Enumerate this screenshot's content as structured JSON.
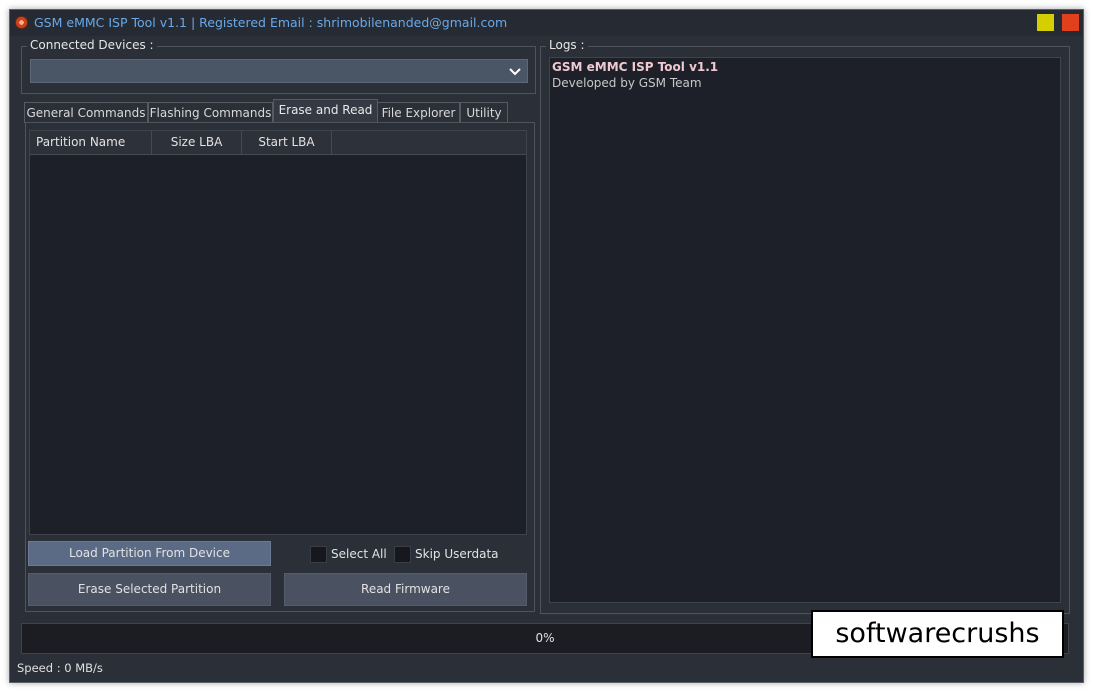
{
  "window": {
    "title": "GSM eMMC ISP Tool v1.1 | Registered Email : shrimobilenanded@gmail.com",
    "colors": {
      "background": "#2b3038",
      "title_text": "#6aa8e8",
      "minimize": "#d4cf00",
      "close": "#e0401c"
    }
  },
  "devices": {
    "label": "Connected Devices :",
    "selected": ""
  },
  "tabs": [
    {
      "label": "General Commands",
      "active": false
    },
    {
      "label": "Flashing Commands",
      "active": false
    },
    {
      "label": "Erase and Read",
      "active": true
    },
    {
      "label": "File Explorer",
      "active": false
    },
    {
      "label": "Utility",
      "active": false
    }
  ],
  "partition_table": {
    "columns": [
      "Partition Name",
      "Size LBA",
      "Start LBA"
    ],
    "rows": []
  },
  "actions": {
    "load_partition": "Load Partition From Device",
    "select_all": "Select All",
    "skip_userdata": "Skip Userdata",
    "erase_selected": "Erase Selected Partition",
    "read_firmware": "Read Firmware"
  },
  "logs": {
    "label": "Logs :",
    "lines": [
      {
        "text": "GSM eMMC ISP Tool v1.1",
        "color": "#f0c8d0",
        "bold": true
      },
      {
        "text": "Developed by GSM Team",
        "color": "#c8c8c8",
        "bold": false
      }
    ]
  },
  "progress": {
    "value": 0,
    "text": "0%"
  },
  "speed": "Speed : 0 MB/s",
  "watermark": "softwarecrushs"
}
